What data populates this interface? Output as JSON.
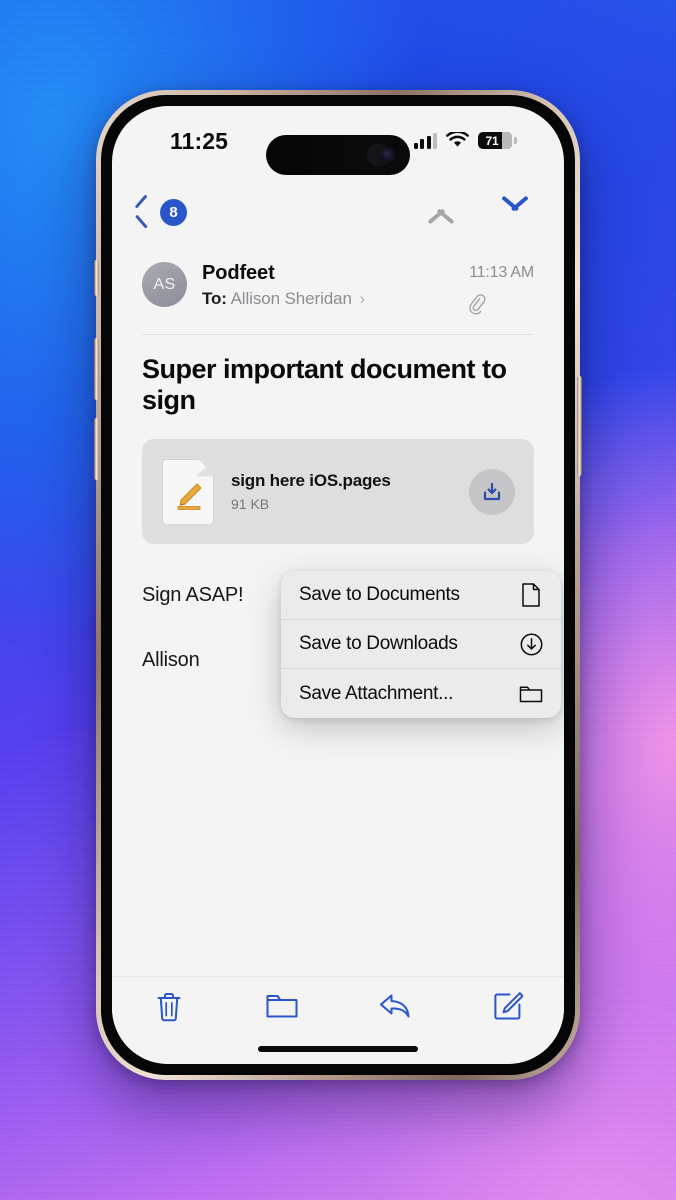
{
  "wallpaper": {
    "colors": [
      "#1f72ee",
      "#2a49e8",
      "#5540ef",
      "#8b57f0",
      "#c06ef0",
      "#e487e6"
    ]
  },
  "device": {
    "name": "iPhone",
    "frame_color": "#c9b2a2"
  },
  "status_bar": {
    "time": "11:25",
    "cellular_icon": "cellular-bars-icon",
    "wifi_icon": "wifi-icon",
    "battery_percent": "71",
    "battery_icon": "battery-icon"
  },
  "nav_bar": {
    "back_icon": "chevron-left-icon",
    "unread_count": "8",
    "previous_icon": "chevron-up-icon",
    "next_icon": "chevron-down-icon",
    "previous_enabled": false,
    "next_enabled": true,
    "accent_color": "#2b56c9",
    "disabled_color": "#a6a6a8"
  },
  "message": {
    "avatar_initials": "AS",
    "sender": "Podfeet",
    "to_label": "To:",
    "recipient": "Allison Sheridan",
    "recipient_disclosure": "›",
    "time": "11:13 AM",
    "attachment_indicator_icon": "paperclip-icon",
    "subject": "Super important document to sign",
    "body_paragraphs": [
      "Sign ASAP!",
      "Allison"
    ]
  },
  "attachment": {
    "file_icon": "pages-document-icon",
    "file_name": "sign here iOS.pages",
    "file_size": "91 KB",
    "download_icon": "download-tray-icon"
  },
  "context_menu": {
    "items": [
      {
        "label": "Save to Documents",
        "icon": "document-icon"
      },
      {
        "label": "Save to Downloads",
        "icon": "download-circle-icon"
      },
      {
        "label": "Save Attachment...",
        "icon": "folder-icon"
      }
    ]
  },
  "toolbar": {
    "items": [
      {
        "name": "delete",
        "icon": "trash-icon"
      },
      {
        "name": "move",
        "icon": "folder-icon"
      },
      {
        "name": "reply",
        "icon": "reply-arrow-icon"
      },
      {
        "name": "compose",
        "icon": "compose-icon"
      }
    ],
    "accent_color": "#2b56c9"
  }
}
